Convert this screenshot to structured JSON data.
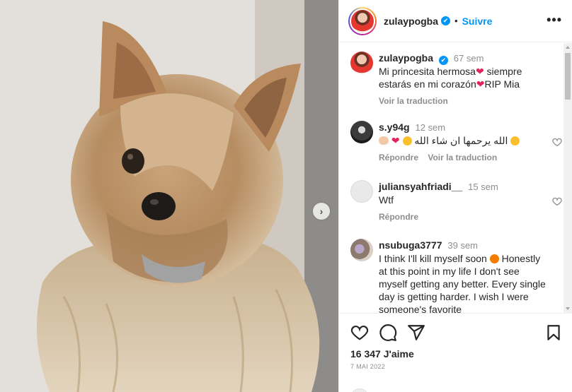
{
  "header": {
    "username": "zulaypogba",
    "verified_symbol": "✔",
    "separator": "•",
    "follow_label": "Suivre",
    "more_label": "•••"
  },
  "media": {
    "next_label": "›"
  },
  "caption": {
    "username": "zulaypogba",
    "verified_symbol": "✔",
    "time": "67 sem",
    "text_a": "Mi princesita hermosa",
    "text_b": " siempre estarás en mi corazón",
    "text_c": "RIP Mia",
    "heart": "❤",
    "translate_label": "Voir la traduction"
  },
  "comments": [
    {
      "username": "s.y94g",
      "time": "12 sem",
      "text": "الله يرحمها ان شاء الله",
      "heart": "❤",
      "reply_label": "Répondre",
      "translate_label": "Voir la traduction"
    },
    {
      "username": "juliansyahfriadi__",
      "time": "15 sem",
      "text": "Wtf",
      "reply_label": "Répondre"
    },
    {
      "username": "nsubuga3777",
      "time": "39 sem",
      "text": "I think I'll kill myself soon",
      "text2": "Honestly at this point in my life I don't see myself getting any better. Every single day is getting harder. I wish I were someone's favorite"
    }
  ],
  "footer": {
    "likes": "16 347 J'aime",
    "date": "7 MAI 2022"
  },
  "colors": {
    "accent": "#0095f6",
    "text": "#262626",
    "muted": "#8e8e8e",
    "heart": "#e0245e"
  },
  "icons": [
    "heart-icon",
    "comment-icon",
    "share-icon",
    "save-icon",
    "more-icon",
    "verified-icon",
    "chevron-right-icon"
  ]
}
